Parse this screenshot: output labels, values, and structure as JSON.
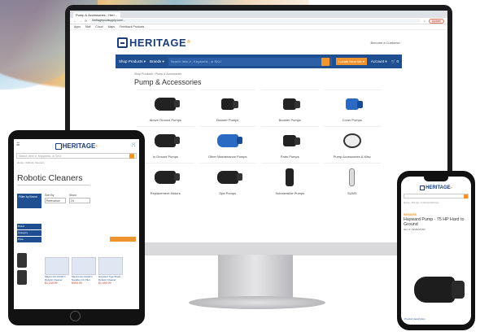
{
  "monitor": {
    "browser": {
      "tab_title": "Pump & Accessories - Heri...",
      "url": "heritagepoolsupply.com/...",
      "update_label": "Update",
      "bookmarks": [
        "Apps",
        "Mail",
        "Cloud",
        "Maps",
        "Feedback Products"
      ]
    },
    "site": {
      "logo": "HERITAGE",
      "logo_reg": "®",
      "account_link": "Become a Customer",
      "nav": {
        "shop_products": "Shop Products ▾",
        "brands": "Brands ▾",
        "search_placeholder": "Search Item # , Keywords , or SKU",
        "locate": "Locate Near Me ▾",
        "account": "Account ▾",
        "cart": "0"
      },
      "breadcrumb": "Shop Products › Pump & Accessories",
      "page_title": "Pump & Accessories",
      "categories": [
        {
          "label": "Above Ground Pumps",
          "icon": "pump-icon"
        },
        {
          "label": "Booster Pumps",
          "icon": "booster-pump-icon"
        },
        {
          "label": "Booster Pumps",
          "icon": "booster-pump-icon"
        },
        {
          "label": "Cover Pumps",
          "icon": "cover-pump-icon"
        },
        {
          "label": "In Ground Pumps",
          "icon": "pump-icon"
        },
        {
          "label": "Other Maintenance Pumps",
          "icon": "maintenance-pump-icon"
        },
        {
          "label": "Parts Pumps",
          "icon": "pump-parts-icon"
        },
        {
          "label": "Pump Accessories & Misc",
          "icon": "pump-accessory-icon"
        },
        {
          "label": "Replacement Motors",
          "icon": "motor-icon"
        },
        {
          "label": "Spa Pumps",
          "icon": "spa-pump-icon"
        },
        {
          "label": "Submersible Pumps",
          "icon": "submersible-pump-icon"
        },
        {
          "label": "SUMS",
          "icon": "filter-icon"
        }
      ]
    }
  },
  "tablet": {
    "logo": "HERITAGE",
    "logo_reg": "®",
    "search_placeholder": "Search Item #, Keywords, or SKU",
    "breadcrumb": "Home › Robotic Cleaners",
    "page_title": "Robotic Cleaners",
    "filter_label": "Filter by Brand",
    "sort_label": "Sort By",
    "sort_value": "Relevance",
    "show_label": "Show",
    "show_value": "24",
    "side_items": [
      "Brand",
      "Category",
      "Price"
    ],
    "cards": [
      {
        "title": "Maytronics Dolphin Robotic Cleaner",
        "price": "$1,249.99"
      },
      {
        "title": "Maytronics Dolphin Nautilus CC Plus",
        "price": "$999.99"
      },
      {
        "title": "Hayward TigerShark Robotic Cleaner",
        "price": "$1,099.99"
      }
    ]
  },
  "phone": {
    "logo": "HERITAGE",
    "logo_reg": "®",
    "breadcrumb": "Home › Pumps › In Ground Pumps",
    "brand": "HAYWARD",
    "product_title": "Hayward Pump - 75 HP Hard to Ground",
    "meta": "Item #: SP2603VSP",
    "footer": "Product description"
  }
}
